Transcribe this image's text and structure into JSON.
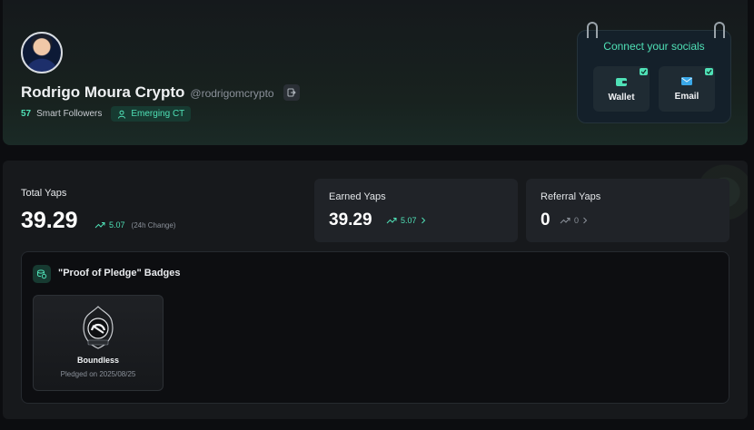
{
  "profile": {
    "name": "Rodrigo Moura Crypto",
    "handle": "@rodrigomcrypto",
    "smart_followers_count": "57",
    "smart_followers_label": "Smart Followers",
    "tier_badge": "Emerging CT"
  },
  "connect": {
    "title": "Connect your socials",
    "buttons": [
      {
        "label": "Wallet",
        "icon": "wallet-icon"
      },
      {
        "label": "Email",
        "icon": "mail-icon"
      }
    ]
  },
  "stats": {
    "total": {
      "label": "Total Yaps",
      "value": "39.29",
      "change": "5.07",
      "change_hint": "(24h Change)"
    },
    "earned": {
      "label": "Earned Yaps",
      "value": "39.29",
      "change": "5.07"
    },
    "referral": {
      "label": "Referral Yaps",
      "value": "0",
      "change": "0"
    }
  },
  "badges": {
    "title": "\"Proof of Pledge\" Badges",
    "items": [
      {
        "name": "Boundless",
        "pledged": "Pledged on 2025/08/25"
      }
    ]
  },
  "colors": {
    "accent": "#4fe0b6",
    "background": "#0c0d10",
    "panel": "#17191c",
    "card": "#202328"
  }
}
